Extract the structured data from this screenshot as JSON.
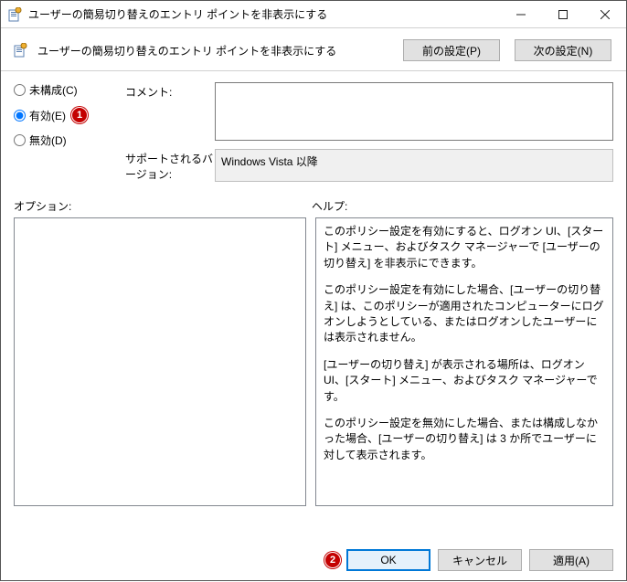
{
  "window": {
    "title": "ユーザーの簡易切り替えのエントリ ポイントを非表示にする"
  },
  "header": {
    "desc": "ユーザーの簡易切り替えのエントリ ポイントを非表示にする",
    "prev_btn": "前の設定(P)",
    "next_btn": "次の設定(N)"
  },
  "radios": {
    "not_configured": "未構成(C)",
    "enabled": "有効(E)",
    "disabled": "無効(D)",
    "selected": "enabled"
  },
  "fields": {
    "comment_label": "コメント:",
    "comment_value": "",
    "supported_label": "サポートされるバージョン:",
    "supported_value": "Windows Vista 以降"
  },
  "options_label": "オプション:",
  "help_label": "ヘルプ:",
  "help_paragraphs": [
    "このポリシー設定を有効にすると、ログオン UI、[スタート] メニュー、およびタスク マネージャーで [ユーザーの切り替え] を非表示にできます。",
    "このポリシー設定を有効にした場合、[ユーザーの切り替え] は、このポリシーが適用されたコンピューターにログオンしようとしている、またはログオンしたユーザーには表示されません。",
    "[ユーザーの切り替え] が表示される場所は、ログオン UI、[スタート] メニュー、およびタスク マネージャーです。",
    "このポリシー設定を無効にした場合、または構成しなかった場合、[ユーザーの切り替え] は 3 か所でユーザーに対して表示されます。"
  ],
  "footer": {
    "ok": "OK",
    "cancel": "キャンセル",
    "apply": "適用(A)"
  },
  "callouts": {
    "one": "1",
    "two": "2"
  }
}
